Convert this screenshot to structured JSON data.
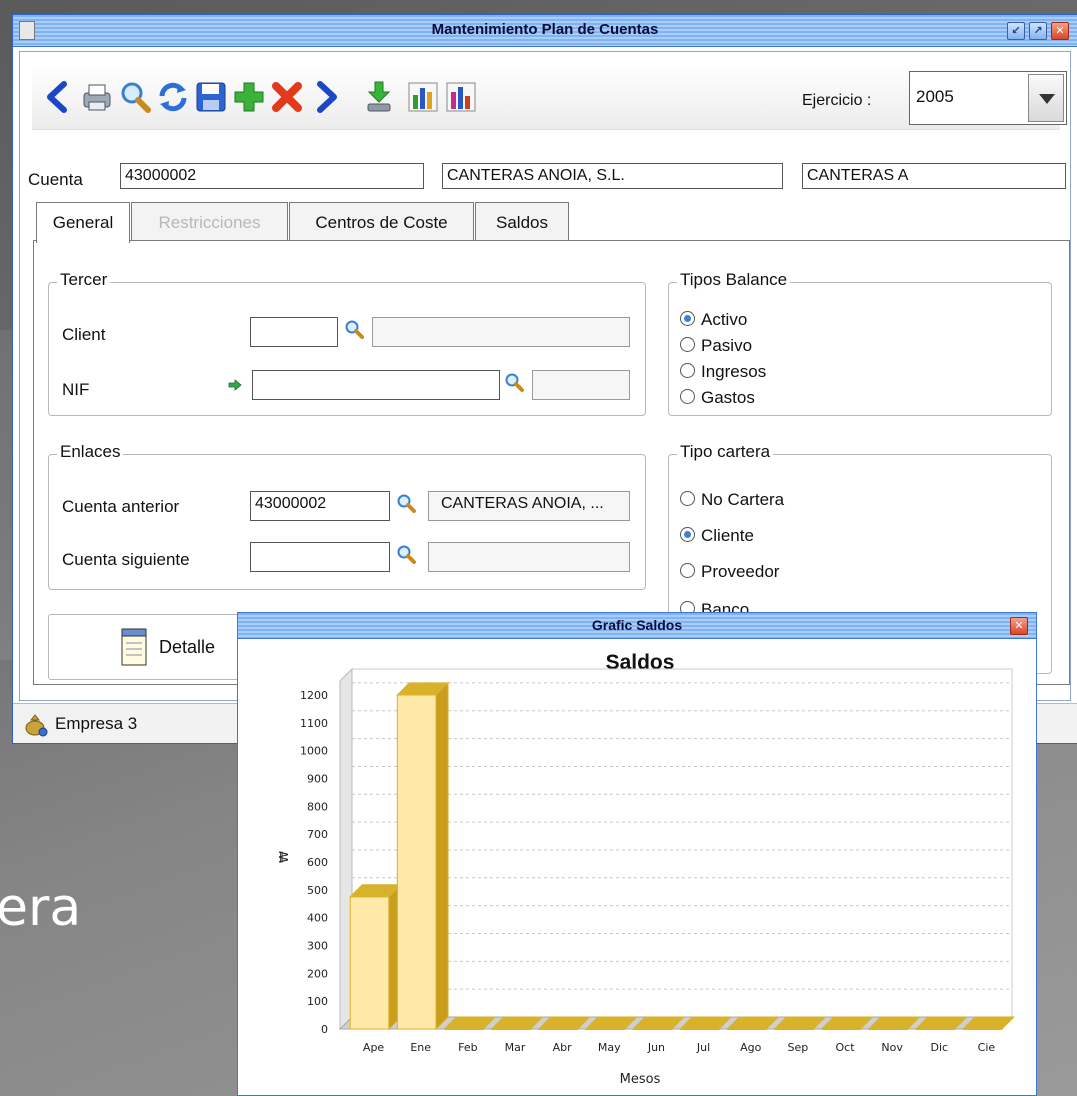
{
  "background": {
    "partial_text": "era"
  },
  "main_window": {
    "title": "Mantenimiento Plan de Cuentas",
    "toolbar": {
      "icons": [
        "prev-icon",
        "print-icon",
        "search-icon",
        "refresh-icon",
        "save-icon",
        "add-icon",
        "delete-icon",
        "next-icon",
        "download-icon",
        "chart-bar-icon",
        "chart-bar-alt-icon"
      ]
    },
    "ejercicio": {
      "label": "Ejercicio :",
      "value": "2005"
    },
    "cuenta": {
      "label": "Cuenta",
      "code": "43000002",
      "name": "CANTERAS ANOIA, S.L.",
      "short": "CANTERAS A"
    },
    "tabs": [
      {
        "label": "General",
        "state": "active"
      },
      {
        "label": "Restricciones",
        "state": "disabled"
      },
      {
        "label": "Centros de Coste",
        "state": "normal"
      },
      {
        "label": "Saldos",
        "state": "normal"
      }
    ],
    "tercer": {
      "title": "Tercer",
      "client_label": "Client",
      "client_value": "",
      "client_desc": "",
      "nif_label": "NIF",
      "nif_value": "",
      "nif_desc": ""
    },
    "tipos_balance": {
      "title": "Tipos Balance",
      "options": [
        {
          "label": "Activo",
          "checked": true
        },
        {
          "label": "Pasivo",
          "checked": false
        },
        {
          "label": "Ingresos",
          "checked": false
        },
        {
          "label": "Gastos",
          "checked": false
        }
      ]
    },
    "enlaces": {
      "title": "Enlaces",
      "anterior_label": "Cuenta anterior",
      "anterior_value": "43000002",
      "anterior_desc": "CANTERAS ANOIA, ...",
      "siguiente_label": "Cuenta siguiente",
      "siguiente_value": "",
      "siguiente_desc": ""
    },
    "tipo_cartera": {
      "title": "Tipo cartera",
      "options": [
        {
          "label": "No Cartera",
          "checked": false
        },
        {
          "label": "Cliente",
          "checked": true
        },
        {
          "label": "Proveedor",
          "checked": false
        },
        {
          "label": "Banco",
          "checked": false
        }
      ]
    },
    "detalle_button": {
      "label": "Detalle"
    },
    "status": {
      "text": "Empresa 3"
    }
  },
  "chart_window": {
    "title": "Grafic Saldos",
    "accent": "#ffe9a8",
    "edge": "#d9b22b"
  },
  "chart_data": {
    "type": "bar",
    "title": "Saldos",
    "xlabel": "Mesos",
    "ylabel": "₩",
    "categories": [
      "Ape",
      "Ene",
      "Feb",
      "Mar",
      "Abr",
      "May",
      "Jun",
      "Jul",
      "Ago",
      "Sep",
      "Oct",
      "Nov",
      "Dic",
      "Cie"
    ],
    "values": [
      475,
      1200,
      0,
      0,
      0,
      0,
      0,
      0,
      0,
      0,
      0,
      0,
      0,
      0
    ],
    "ylim": [
      0,
      1250
    ],
    "yticks": [
      0,
      100,
      200,
      300,
      400,
      500,
      600,
      700,
      800,
      900,
      1000,
      1100,
      1200
    ],
    "grid": true,
    "legend": "none"
  }
}
